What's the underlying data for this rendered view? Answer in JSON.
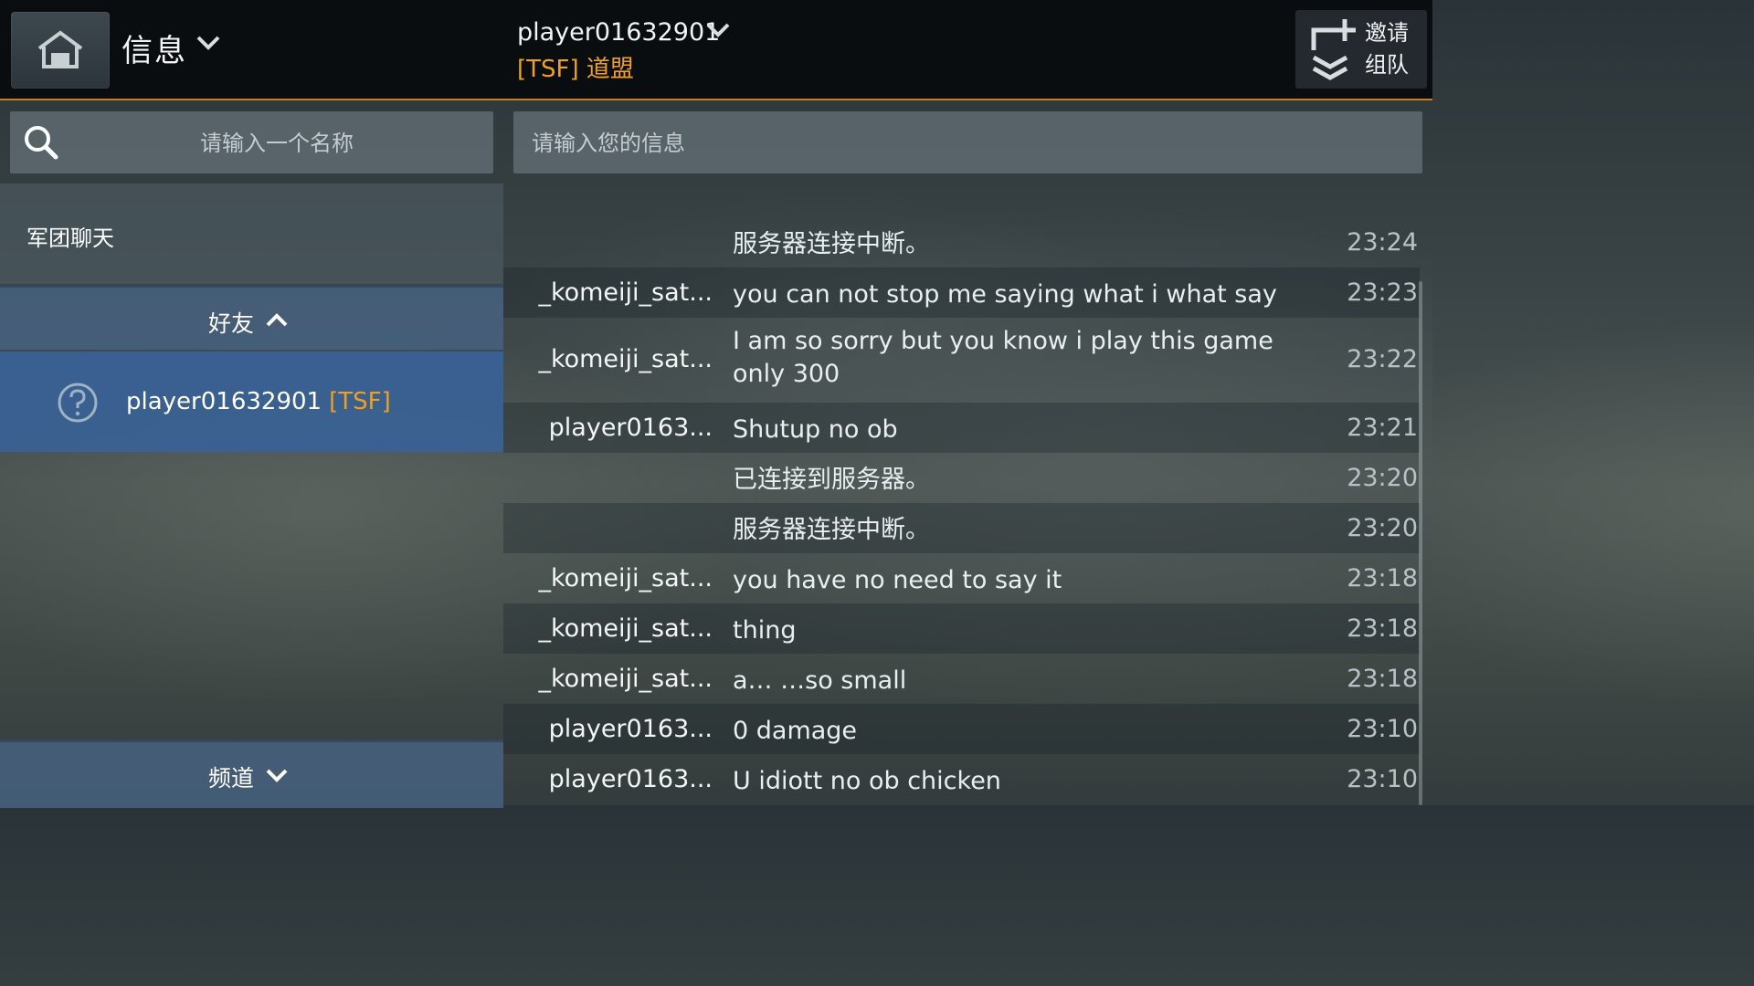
{
  "header": {
    "nav_title": "信息",
    "player_name": "player01632901",
    "player_clan": "[TSF] 道盟",
    "invite_line1": "邀请",
    "invite_line2": "组队"
  },
  "sidebar": {
    "search_placeholder": "请输入一个名称",
    "legion_chat_label": "军团聊天",
    "friends_label": "好友",
    "friends": [
      {
        "name": "player01632901",
        "clan": "[TSF]"
      }
    ],
    "channels_label": "频道"
  },
  "chat": {
    "input_placeholder": "请输入您的信息",
    "messages": [
      {
        "sender": "",
        "text": "服务器连接中断。",
        "time": "23:24"
      },
      {
        "sender": "_komeiji_sat...",
        "text": "you can not stop me saying what i what say",
        "time": "23:23"
      },
      {
        "sender": "_komeiji_sat...",
        "text": "I am so sorry but you know i play this game only 300",
        "time": "23:22"
      },
      {
        "sender": "player0163...",
        "text": "Shutup no ob",
        "time": "23:21"
      },
      {
        "sender": "",
        "text": "已连接到服务器。",
        "time": "23:20"
      },
      {
        "sender": "",
        "text": "服务器连接中断。",
        "time": "23:20"
      },
      {
        "sender": "_komeiji_sat...",
        "text": "you have no need to say it",
        "time": "23:18"
      },
      {
        "sender": "_komeiji_sat...",
        "text": "thing",
        "time": "23:18"
      },
      {
        "sender": "_komeiji_sat...",
        "text": "a… …so small",
        "time": "23:18"
      },
      {
        "sender": "player0163...",
        "text": "0 damage",
        "time": "23:10"
      },
      {
        "sender": "player0163...",
        "text": "U idiott no ob chicken",
        "time": "23:10"
      }
    ]
  },
  "colors": {
    "accent_orange": "#f0a020",
    "topbar_border": "#c8801e",
    "selected_row": "#38629a"
  }
}
